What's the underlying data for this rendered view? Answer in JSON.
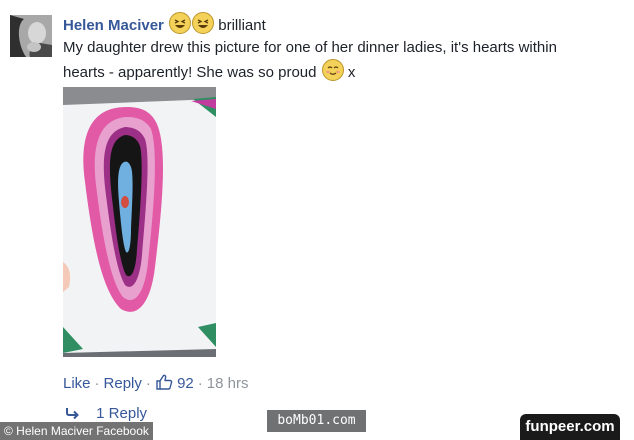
{
  "comment": {
    "author": "Helen Maciver",
    "status_text": "brilliant",
    "emojis": [
      "grinning-squint-face",
      "grinning-squint-face"
    ],
    "body_line1": "My daughter drew this picture for one of her dinner ladies, it's hearts within",
    "body_line2_prefix": "hearts - apparently! She was so proud",
    "body_trailing_emoji": "smiling-face",
    "body_suffix": "x"
  },
  "actions": {
    "like_label": "Like",
    "reply_label": "Reply",
    "like_count": "92",
    "timestamp": "18 hrs",
    "separator": "·"
  },
  "replies": {
    "label": "1 Reply"
  },
  "overlays": {
    "credit": "© Helen Maciver Facebook",
    "watermark": "boMb01.com",
    "brand": "funpeer.com"
  },
  "colors": {
    "link": "#365899",
    "muted": "#90949c",
    "text": "#1d2129"
  }
}
